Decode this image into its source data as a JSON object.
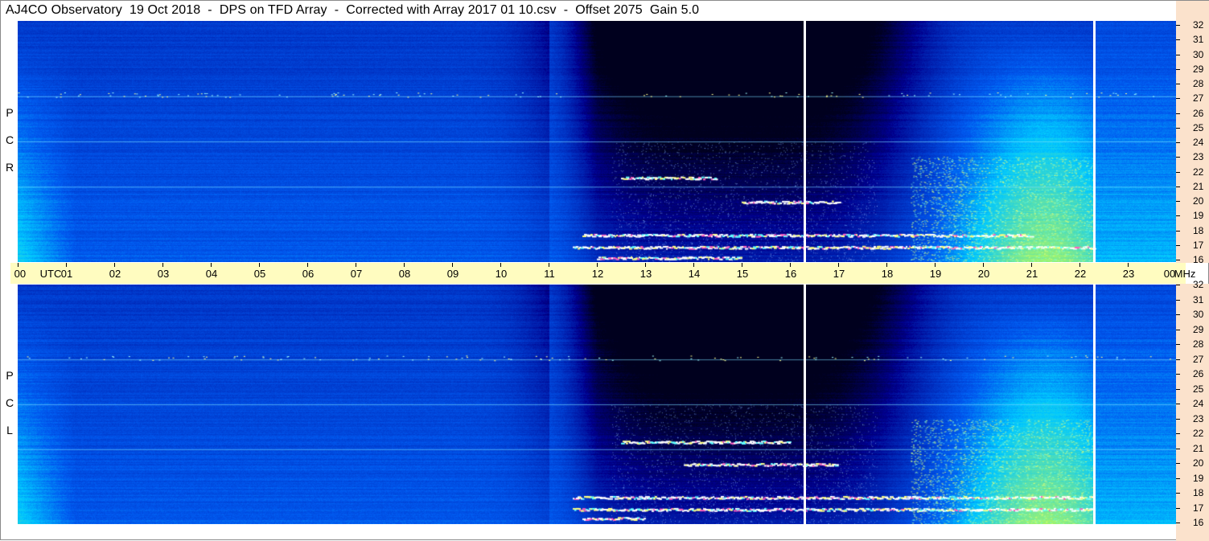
{
  "title": "AJ4CO Observatory  19 Oct 2018  -  DPS on TFD Array  -  Corrected with Array 2017 01 10.csv  -  Offset 2075  Gain 5.0",
  "colors": {
    "background_blue": "#0a3fd0",
    "axis_band": "#fffcc0",
    "freq_band": "#fbe2cc",
    "marker_line": "#ffffff"
  },
  "chart_data": [
    {
      "type": "heatmap",
      "name": "RCP",
      "side_label": [
        "R",
        "C",
        "P"
      ],
      "x_label": "UTC",
      "x_ticks": [
        "00",
        "01",
        "02",
        "03",
        "04",
        "05",
        "06",
        "07",
        "08",
        "09",
        "10",
        "11",
        "12",
        "13",
        "14",
        "15",
        "16",
        "17",
        "18",
        "19",
        "20",
        "21",
        "22",
        "23",
        "00"
      ],
      "x_range_hours": [
        0,
        24
      ],
      "y_unit": "MHz",
      "y_range": [
        16,
        32
      ],
      "y_ticks": [
        "32",
        "31",
        "30",
        "29",
        "28",
        "27",
        "26",
        "25",
        "24",
        "23",
        "22",
        "21",
        "20",
        "19",
        "18",
        "17",
        "16"
      ],
      "marker_lines_utc": [
        16.3,
        22.3
      ]
    },
    {
      "type": "heatmap",
      "name": "LCP",
      "side_label": [
        "L",
        "C",
        "P"
      ],
      "x_range_hours": [
        0,
        24
      ],
      "y_range": [
        16,
        32
      ],
      "y_ticks": [
        "32",
        "31",
        "30",
        "29",
        "28",
        "27",
        "26",
        "25",
        "24",
        "23",
        "22",
        "21",
        "20",
        "19",
        "18",
        "17",
        "16"
      ],
      "marker_lines_utc": [
        16.3,
        22.3
      ]
    }
  ],
  "axis": {
    "x_unit_label": "UTC",
    "y_unit_label": "MHz"
  }
}
